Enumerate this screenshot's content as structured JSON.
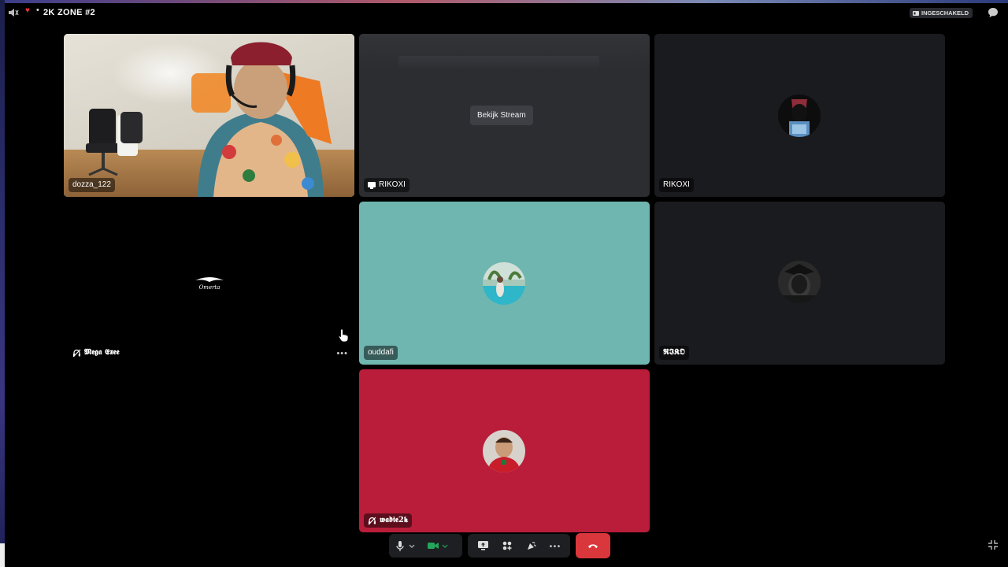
{
  "header": {
    "title": "2K ZONE #2",
    "status_badge": "INGESCHAKELD"
  },
  "tiles": [
    {
      "name": "dozza_122",
      "type": "video"
    },
    {
      "name": "RIKOXI",
      "type": "stream",
      "watch_label": "Bekijk Stream"
    },
    {
      "name": "RIKOXI",
      "type": "avatar"
    },
    {
      "name": "𝕸𝖊𝖌𝖆 𝕰𝖝𝖊𝖊",
      "type": "avatar",
      "muted_deafened": true
    },
    {
      "name": "ouddafi",
      "type": "avatar",
      "bg_color": "#6fb6b0"
    },
    {
      "name": "𝕽𝕴𝕶𝕺",
      "type": "avatar"
    },
    {
      "name": "𝖜𝖆𝖉𝖎𝖊2𝖐",
      "type": "avatar",
      "muted_deafened": true,
      "bg_color": "#b91d3a"
    }
  ],
  "controls": {
    "icons": [
      "microphone-icon",
      "camera-icon",
      "screen-share-icon",
      "activities-icon",
      "soundboard-icon",
      "more-icon",
      "hang-up-icon"
    ]
  },
  "colors": {
    "camera_on": "#23a55a",
    "end_call": "#da373c"
  }
}
